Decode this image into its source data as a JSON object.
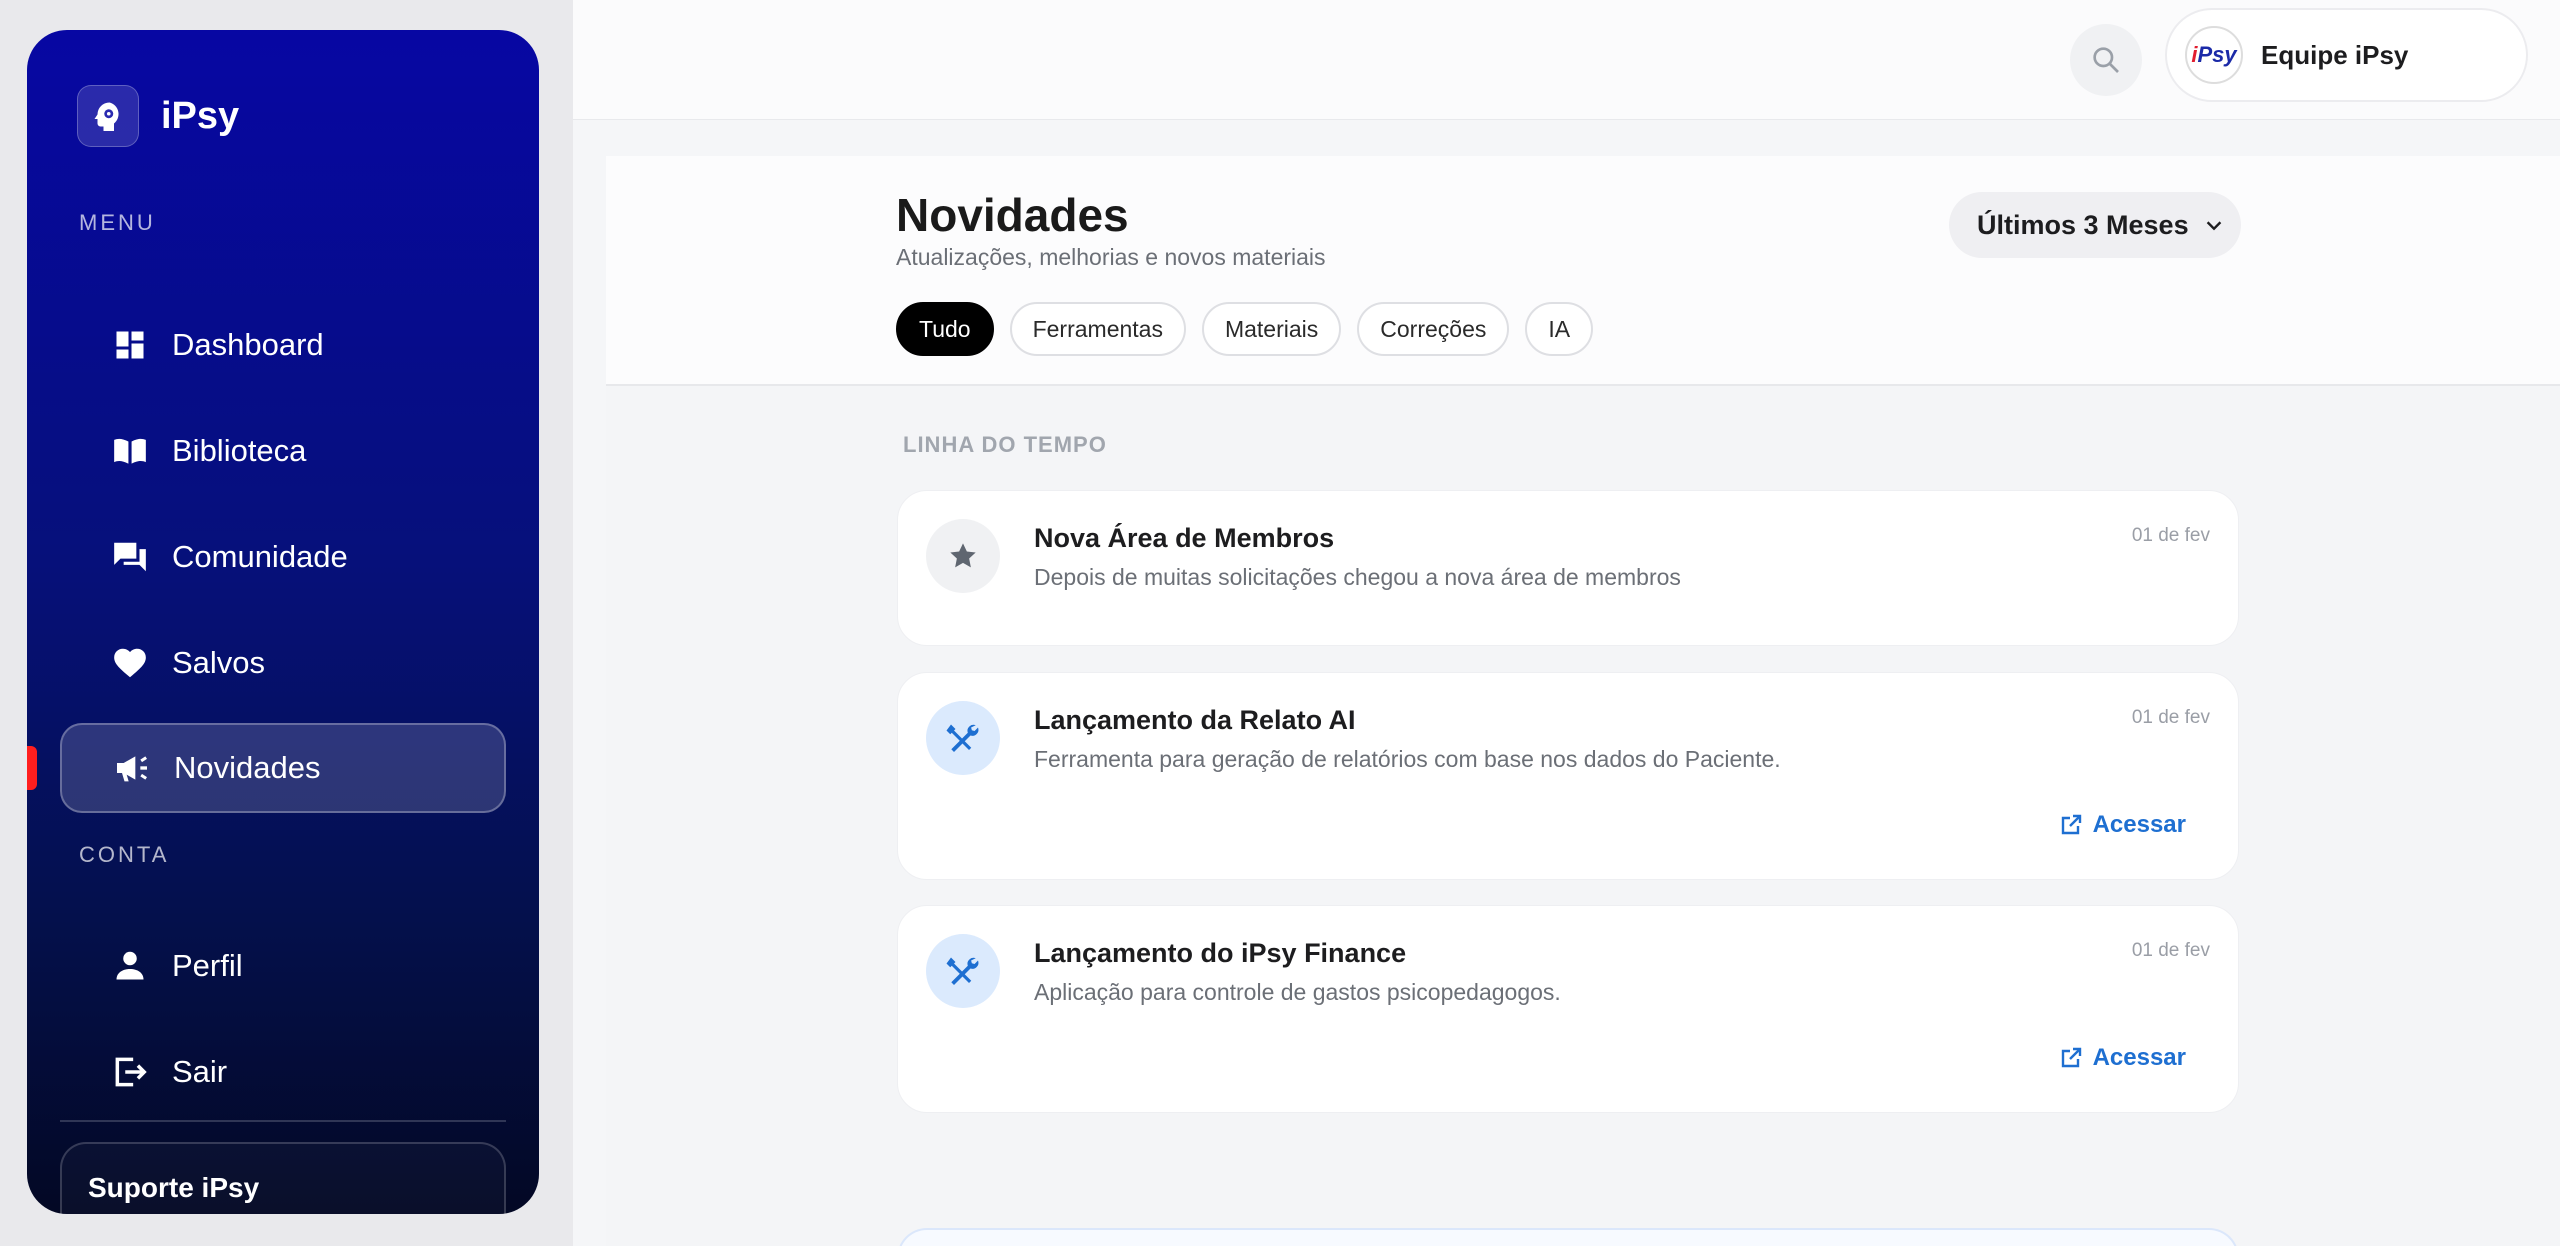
{
  "app": {
    "name": "iPsy"
  },
  "sidebar": {
    "menu_label": "MENU",
    "account_label": "CONTA",
    "items": [
      {
        "label": "Dashboard",
        "icon": "dashboard-icon"
      },
      {
        "label": "Biblioteca",
        "icon": "book-icon"
      },
      {
        "label": "Comunidade",
        "icon": "chat-icon"
      },
      {
        "label": "Salvos",
        "icon": "heart-icon"
      },
      {
        "label": "Novidades",
        "icon": "megaphone-icon",
        "active": true
      }
    ],
    "account_items": [
      {
        "label": "Perfil",
        "icon": "person-icon"
      },
      {
        "label": "Sair",
        "icon": "logout-icon"
      }
    ],
    "support_label": "Suporte iPsy"
  },
  "topbar": {
    "user_name": "Equipe iPsy",
    "avatar_text_i": "i",
    "avatar_text_psy": "Psy"
  },
  "page": {
    "title": "Novidades",
    "subtitle": "Atualizações, melhorias e novos materiais",
    "period": "Últimos 3 Meses",
    "filters": [
      "Tudo",
      "Ferramentas",
      "Materiais",
      "Correções",
      "IA"
    ],
    "active_filter": "Tudo",
    "timeline_label": "LINHA DO TEMPO"
  },
  "news": [
    {
      "title": "Nova Área de Membros",
      "description": "Depois de muitas solicitações chegou a nova área de membros",
      "date": "01 de fev",
      "icon": "star-icon"
    },
    {
      "title": "Lançamento da Relato AI",
      "description": "Ferramenta para geração de relatórios com base nos dados do Paciente.",
      "date": "01 de fev",
      "icon": "tools-icon",
      "link_label": "Acessar"
    },
    {
      "title": "Lançamento do iPsy Finance",
      "description": "Aplicação para controle de gastos psicopedagogos.",
      "date": "01 de fev",
      "icon": "tools-icon",
      "link_label": "Acessar"
    }
  ],
  "colors": {
    "sidebar_top": "#0707a3",
    "sidebar_bottom": "#030824",
    "accent_link": "#1e6fd1",
    "active_marker": "#ff1e1e"
  }
}
